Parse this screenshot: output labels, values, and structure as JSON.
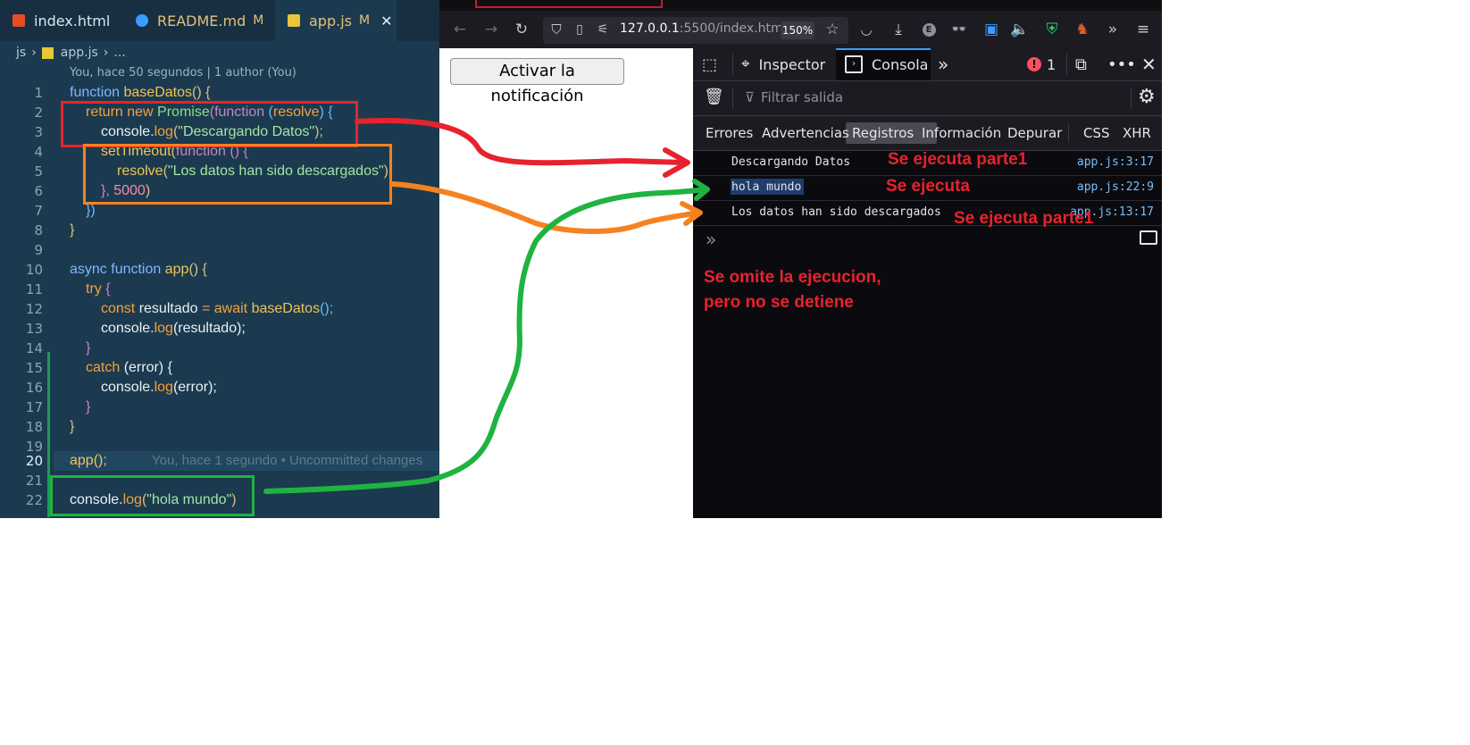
{
  "editor": {
    "tabs": [
      {
        "label": "index.html",
        "modified": ""
      },
      {
        "label": "README.md",
        "modified": "M"
      },
      {
        "label": "app.js",
        "modified": "M",
        "active": true
      }
    ],
    "breadcrumb": {
      "folder": "js",
      "file": "app.js",
      "rest": "..."
    },
    "blame": "You, hace 50 segundos | 1 author (You)",
    "line_numbers": [
      "1",
      "2",
      "3",
      "4",
      "5",
      "6",
      "7",
      "8",
      "9",
      "10",
      "11",
      "12",
      "13",
      "14",
      "15",
      "16",
      "17",
      "18",
      "19",
      "20",
      "21",
      "22"
    ],
    "code": {
      "l1": {
        "kw": "function",
        "fn": "baseDatos",
        "rest": "() {"
      },
      "l2": {
        "kw": "return new",
        "fn": "Promise",
        "p1": "(",
        "kw2": "function",
        "p2": " (",
        "arg": "resolve",
        "p3": ") {"
      },
      "l3": {
        "obj": "console.",
        "fn": "log",
        "p1": "(",
        "str": "\"Descargando Datos\"",
        "p2": ");"
      },
      "l4": {
        "fn": "setTimeout",
        "p1": "(",
        "kw": "function",
        "p2": " () {"
      },
      "l5": {
        "fn": "resolve",
        "p1": "(",
        "str": "\"Los datos han sido descargados\"",
        "p2": ")"
      },
      "l6": {
        "p1": "}, ",
        "num": "5000",
        "p2": ")"
      },
      "l7": "})",
      "l8": "}",
      "l10": {
        "kw": "async function",
        "fn": "app",
        "rest": "() {"
      },
      "l11": {
        "kw": "try",
        "rest": " {"
      },
      "l12": {
        "kw": "const",
        "var": " resultado ",
        "op": "= ",
        "kw2": "await",
        "fn": " baseDatos",
        "rest": "();"
      },
      "l13": {
        "obj": "console.",
        "fn": "log",
        "rest": "(resultado);"
      },
      "l14": "}",
      "l15": {
        "kw": "catch",
        "rest": " (error) {"
      },
      "l16": {
        "obj": "console.",
        "fn": "log",
        "rest": "(error);"
      },
      "l17": "}",
      "l18": "}",
      "l20": {
        "call": "app();",
        "ghost": "You, hace 1 segundo • Uncommitted changes"
      },
      "l22": {
        "obj": "console.",
        "fn": "log",
        "p1": "(",
        "str": "\"hola mundo\"",
        "p2": ")"
      }
    }
  },
  "browser": {
    "url_host": "127.0.0.1",
    "url_path": ":5500/index.html",
    "zoom": "150%",
    "page_button": "Activar la notificación"
  },
  "devtools": {
    "tabs": {
      "inspector": "Inspector",
      "console": "Consola"
    },
    "error_count": "1",
    "filter_placeholder": "Filtrar salida",
    "levels": [
      "Errores",
      "Advertencias",
      "Registros",
      "Información",
      "Depurar",
      "CSS",
      "XHR"
    ],
    "active_level": "Registros",
    "messages": [
      {
        "text": "Descargando Datos",
        "source": "app.js:3:17"
      },
      {
        "text": "hola mundo",
        "source": "app.js:22:9"
      },
      {
        "text": "Los datos han sido descargados",
        "source": "app.js:13:17"
      }
    ]
  },
  "annotations": {
    "a1": "Se ejecuta parte1",
    "a2": "Se ejecuta",
    "a3": "Se ejecuta parte1",
    "note_line1": "Se omite la ejecucion,",
    "note_line2": "pero no se detiene",
    "colors": {
      "red": "#e8222d",
      "orange": "#f58220",
      "green": "#1fb341"
    }
  }
}
